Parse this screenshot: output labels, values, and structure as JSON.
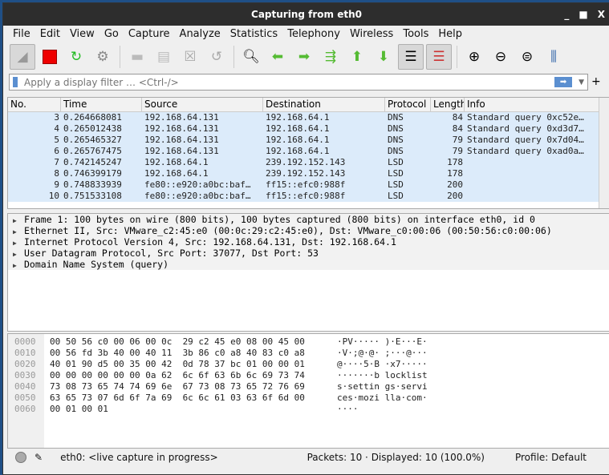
{
  "window": {
    "title": "Capturing from eth0"
  },
  "menu": [
    "File",
    "Edit",
    "View",
    "Go",
    "Capture",
    "Analyze",
    "Statistics",
    "Telephony",
    "Wireless",
    "Tools",
    "Help"
  ],
  "filter": {
    "placeholder": "Apply a display filter … <Ctrl-/>"
  },
  "columns": [
    "No.",
    "Time",
    "Source",
    "Destination",
    "Protocol",
    "Length",
    "Info"
  ],
  "packets": [
    [
      "3",
      "0.264668081",
      "192.168.64.131",
      "192.168.64.1",
      "DNS",
      "84",
      "Standard query 0xc52e…"
    ],
    [
      "4",
      "0.265012438",
      "192.168.64.131",
      "192.168.64.1",
      "DNS",
      "84",
      "Standard query 0xd3d7…"
    ],
    [
      "5",
      "0.265465327",
      "192.168.64.131",
      "192.168.64.1",
      "DNS",
      "79",
      "Standard query 0x7d04…"
    ],
    [
      "6",
      "0.265767475",
      "192.168.64.131",
      "192.168.64.1",
      "DNS",
      "79",
      "Standard query 0xad0a…"
    ],
    [
      "7",
      "0.742145247",
      "192.168.64.1",
      "239.192.152.143",
      "LSD",
      "178",
      ""
    ],
    [
      "8",
      "0.746399179",
      "192.168.64.1",
      "239.192.152.143",
      "LSD",
      "178",
      ""
    ],
    [
      "9",
      "0.748833939",
      "fe80::e920:a0bc:baf…",
      "ff15::efc0:988f",
      "LSD",
      "200",
      ""
    ],
    [
      "10",
      "0.751533108",
      "fe80::e920:a0bc:baf…",
      "ff15::efc0:988f",
      "LSD",
      "200",
      ""
    ]
  ],
  "details": [
    "Frame 1: 100 bytes on wire (800 bits), 100 bytes captured (800 bits) on interface eth0, id 0",
    "Ethernet II, Src: VMware_c2:45:e0 (00:0c:29:c2:45:e0), Dst: VMware_c0:00:06 (00:50:56:c0:00:06)",
    "Internet Protocol Version 4, Src: 192.168.64.131, Dst: 192.168.64.1",
    "User Datagram Protocol, Src Port: 37077, Dst Port: 53",
    "Domain Name System (query)"
  ],
  "hex": [
    [
      "0000",
      "00 50 56 c0 00 06 00 0c  29 c2 45 e0 08 00 45 00",
      "·PV····· )·E···E·"
    ],
    [
      "0010",
      "00 56 fd 3b 40 00 40 11  3b 86 c0 a8 40 83 c0 a8",
      "·V·;@·@· ;···@···"
    ],
    [
      "0020",
      "40 01 90 d5 00 35 00 42  0d 78 37 bc 01 00 00 01",
      "@····5·B ·x7·····"
    ],
    [
      "0030",
      "00 00 00 00 00 00 0a 62  6c 6f 63 6b 6c 69 73 74",
      "·······b locklist"
    ],
    [
      "0040",
      "73 08 73 65 74 74 69 6e  67 73 08 73 65 72 76 69",
      "s·settin gs·servi"
    ],
    [
      "0050",
      "63 65 73 07 6d 6f 7a 69  6c 6c 61 03 63 6f 6d 00",
      "ces·mozi lla·com·"
    ],
    [
      "0060",
      "00 01 00 01",
      "····"
    ]
  ],
  "status": {
    "capture": "eth0: <live capture in progress>",
    "packets": "Packets: 10 · Displayed: 10 (100.0%)",
    "profile": "Profile: Default"
  }
}
